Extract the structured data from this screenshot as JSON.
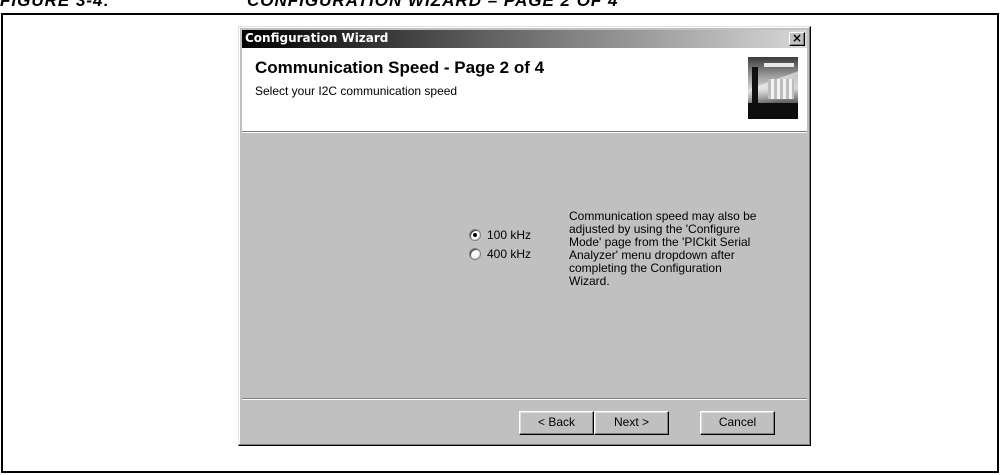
{
  "figure": {
    "number": "FIGURE 3-4:",
    "title": "CONFIGURATION WIZARD – PAGE 2 OF 4"
  },
  "window": {
    "title": "Configuration Wizard",
    "close_glyph": "×"
  },
  "header": {
    "heading": "Communication Speed  -  Page 2 of 4",
    "subheading": "Select your I2C communication speed"
  },
  "speed_options": [
    {
      "label": "100 kHz",
      "selected": true
    },
    {
      "label": "400 kHz",
      "selected": false
    }
  ],
  "info_lines": [
    "Communication speed may also be",
    "adjusted by using the 'Configure",
    "Mode' page from the 'PICkit Serial",
    "Analyzer' menu dropdown after",
    "completing the Configuration",
    "Wizard."
  ],
  "buttons": {
    "back": "< Back",
    "next": "Next >",
    "cancel": "Cancel"
  }
}
